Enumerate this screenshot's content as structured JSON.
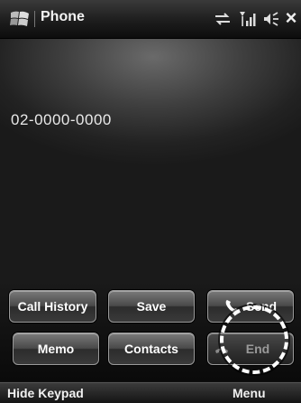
{
  "titlebar": {
    "title": "Phone",
    "close_label": "×",
    "icons": [
      "windows-start-icon",
      "sync-icon",
      "signal-icon",
      "volume-icon"
    ]
  },
  "display": {
    "number": "02-0000-0000"
  },
  "keypad": {
    "call_history": "Call History",
    "save": "Save",
    "send": "Send",
    "memo": "Memo",
    "contacts": "Contacts",
    "end": "End"
  },
  "softkeys": {
    "left": "Hide Keypad",
    "right": "Menu"
  },
  "colors": {
    "background": "#111111",
    "button_text": "#ffffff",
    "send_icon": "#ffffff",
    "end_disabled_text": "#9a9a9a"
  }
}
